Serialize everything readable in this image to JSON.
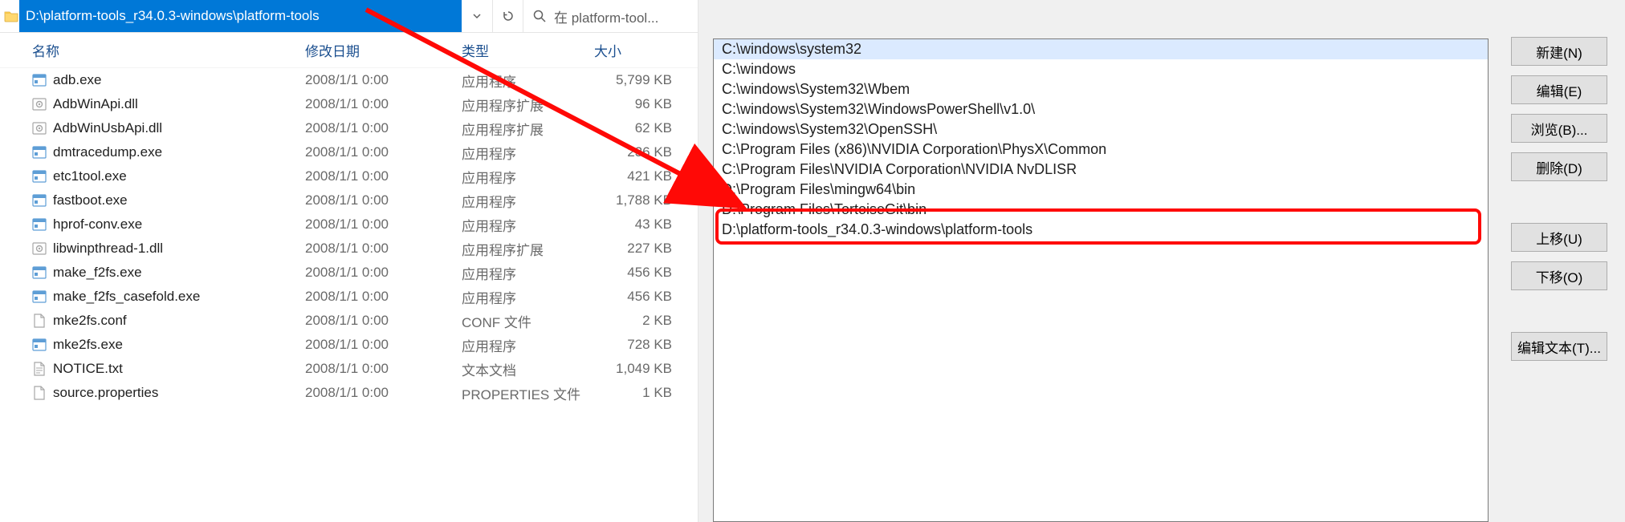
{
  "address_bar": {
    "path": "D:\\platform-tools_r34.0.3-windows\\platform-tools"
  },
  "search": {
    "placeholder": "在 platform-tool..."
  },
  "columns": {
    "name": "名称",
    "date": "修改日期",
    "type": "类型",
    "size": "大小"
  },
  "files": [
    {
      "name": "adb.exe",
      "date": "2008/1/1 0:00",
      "type": "应用程序",
      "size": "5,799 KB",
      "icon": "exe"
    },
    {
      "name": "AdbWinApi.dll",
      "date": "2008/1/1 0:00",
      "type": "应用程序扩展",
      "size": "96 KB",
      "icon": "dll"
    },
    {
      "name": "AdbWinUsbApi.dll",
      "date": "2008/1/1 0:00",
      "type": "应用程序扩展",
      "size": "62 KB",
      "icon": "dll"
    },
    {
      "name": "dmtracedump.exe",
      "date": "2008/1/1 0:00",
      "type": "应用程序",
      "size": "236 KB",
      "icon": "exe"
    },
    {
      "name": "etc1tool.exe",
      "date": "2008/1/1 0:00",
      "type": "应用程序",
      "size": "421 KB",
      "icon": "exe"
    },
    {
      "name": "fastboot.exe",
      "date": "2008/1/1 0:00",
      "type": "应用程序",
      "size": "1,788 KB",
      "icon": "exe"
    },
    {
      "name": "hprof-conv.exe",
      "date": "2008/1/1 0:00",
      "type": "应用程序",
      "size": "43 KB",
      "icon": "exe"
    },
    {
      "name": "libwinpthread-1.dll",
      "date": "2008/1/1 0:00",
      "type": "应用程序扩展",
      "size": "227 KB",
      "icon": "dll"
    },
    {
      "name": "make_f2fs.exe",
      "date": "2008/1/1 0:00",
      "type": "应用程序",
      "size": "456 KB",
      "icon": "exe"
    },
    {
      "name": "make_f2fs_casefold.exe",
      "date": "2008/1/1 0:00",
      "type": "应用程序",
      "size": "456 KB",
      "icon": "exe"
    },
    {
      "name": "mke2fs.conf",
      "date": "2008/1/1 0:00",
      "type": "CONF 文件",
      "size": "2 KB",
      "icon": "file"
    },
    {
      "name": "mke2fs.exe",
      "date": "2008/1/1 0:00",
      "type": "应用程序",
      "size": "728 KB",
      "icon": "exe"
    },
    {
      "name": "NOTICE.txt",
      "date": "2008/1/1 0:00",
      "type": "文本文档",
      "size": "1,049 KB",
      "icon": "txt"
    },
    {
      "name": "source.properties",
      "date": "2008/1/1 0:00",
      "type": "PROPERTIES 文件",
      "size": "1 KB",
      "icon": "file"
    }
  ],
  "env_list": [
    {
      "path": "C:\\windows\\system32",
      "selected": true
    },
    {
      "path": "C:\\windows"
    },
    {
      "path": "C:\\windows\\System32\\Wbem"
    },
    {
      "path": "C:\\windows\\System32\\WindowsPowerShell\\v1.0\\"
    },
    {
      "path": "C:\\windows\\System32\\OpenSSH\\"
    },
    {
      "path": "C:\\Program Files (x86)\\NVIDIA Corporation\\PhysX\\Common"
    },
    {
      "path": "C:\\Program Files\\NVIDIA Corporation\\NVIDIA NvDLISR"
    },
    {
      "path": "D:\\Program Files\\mingw64\\bin"
    },
    {
      "path": "D:\\Program Files\\TortoiseGit\\bin"
    },
    {
      "path": "D:\\platform-tools_r34.0.3-windows\\platform-tools",
      "highlight": true
    }
  ],
  "buttons": {
    "new": "新建(N)",
    "edit": "编辑(E)",
    "browse": "浏览(B)...",
    "delete": "删除(D)",
    "moveup": "上移(U)",
    "movedown": "下移(O)",
    "edittext": "编辑文本(T)..."
  },
  "annotation": {
    "arrow_color": "#ff0906",
    "highlight_color": "#ff0906"
  }
}
